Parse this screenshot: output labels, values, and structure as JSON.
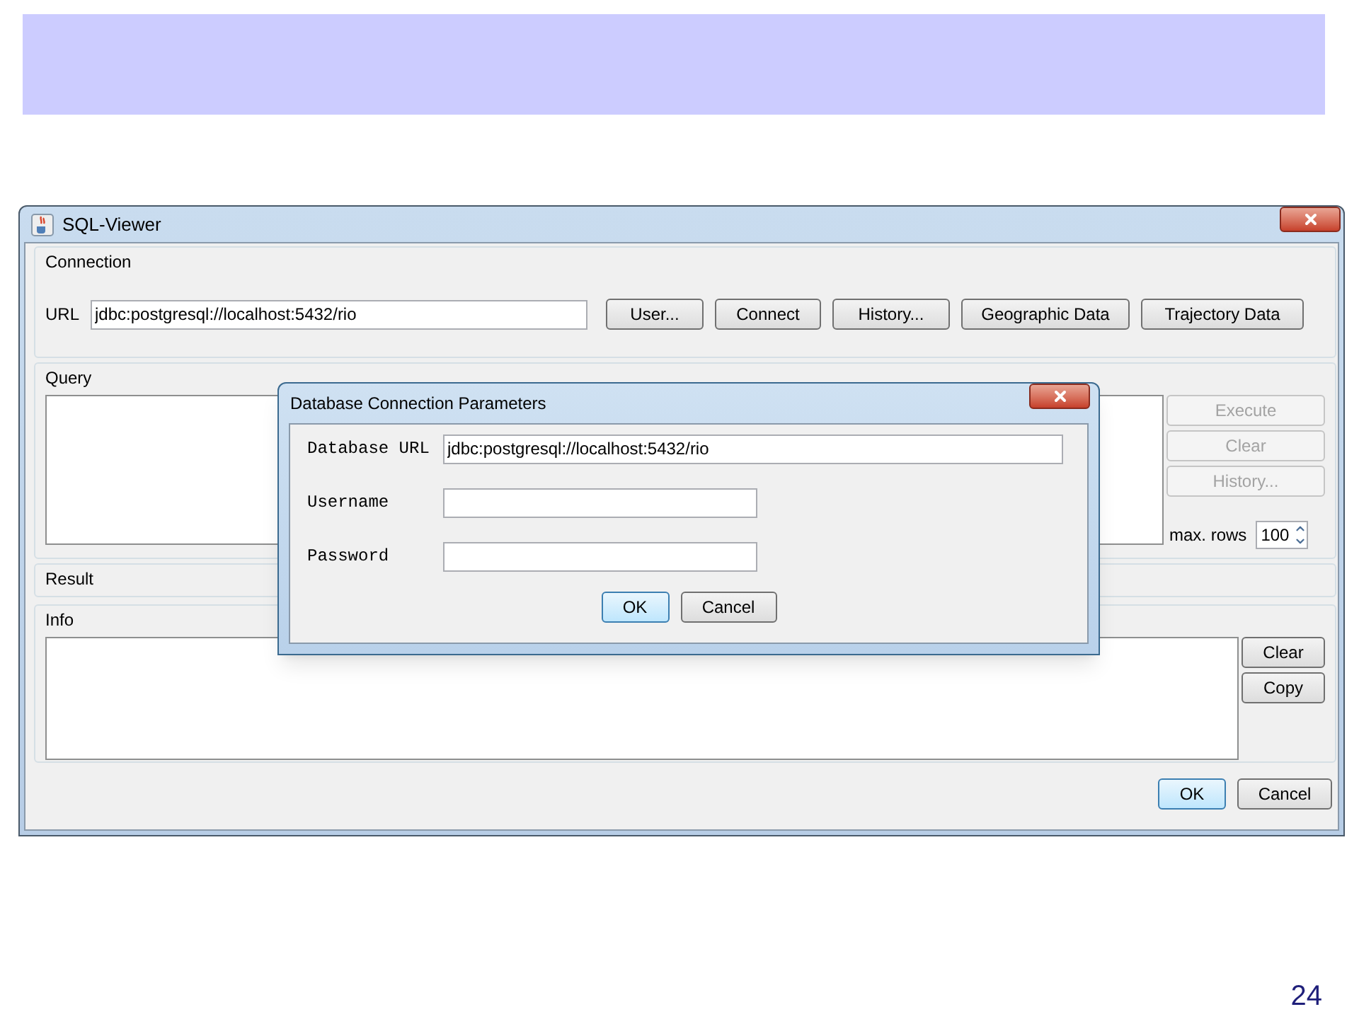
{
  "slide": {
    "page_number": "24"
  },
  "window": {
    "title": "SQL-Viewer"
  },
  "connection": {
    "label": "Connection",
    "url_label": "URL",
    "url_value": "jdbc:postgresql://localhost:5432/rio",
    "buttons": [
      "User...",
      "Connect",
      "History...",
      "Geographic Data",
      "Trajectory Data"
    ]
  },
  "query": {
    "label": "Query",
    "buttons": [
      {
        "label": "Execute",
        "disabled": true
      },
      {
        "label": "Clear",
        "disabled": true
      },
      {
        "label": "History...",
        "disabled": true
      }
    ],
    "max_rows_label": "max. rows",
    "max_rows_value": "100"
  },
  "result": {
    "label": "Result"
  },
  "info": {
    "label": "Info",
    "buttons": [
      "Clear",
      "Copy"
    ]
  },
  "buttons": [
    {
      "label": "OK",
      "default": true
    },
    {
      "label": "Cancel",
      "default": false
    }
  ],
  "dialog": {
    "title": "Database Connection Parameters",
    "fields": [
      {
        "label": "Database URL",
        "value": "jdbc:postgresql://localhost:5432/rio",
        "wide": true
      },
      {
        "label": "Username",
        "wide": false
      },
      {
        "label": "Password",
        "wide": false
      }
    ],
    "buttons": [
      {
        "label": "OK",
        "default": true
      },
      {
        "label": "Cancel",
        "default": false
      }
    ]
  }
}
